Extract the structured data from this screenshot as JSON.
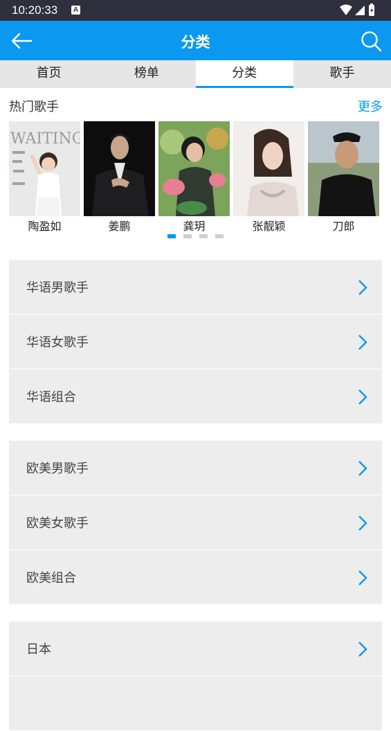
{
  "status": {
    "time": "10:20:33",
    "badge": "A"
  },
  "appbar": {
    "title": "分类"
  },
  "tabs": [
    {
      "label": "首页"
    },
    {
      "label": "榜单"
    },
    {
      "label": "分类"
    },
    {
      "label": "歌手"
    }
  ],
  "hot": {
    "title": "热门歌手",
    "more": "更多",
    "singers": [
      {
        "name": "陶盈如",
        "photo_text": "WAITING"
      },
      {
        "name": "姜鹏"
      },
      {
        "name": "龚玥"
      },
      {
        "name": "张靓颖"
      },
      {
        "name": "刀郎"
      }
    ],
    "page_count": 4,
    "active_page": 1
  },
  "groups": [
    {
      "items": [
        {
          "label": "华语男歌手"
        },
        {
          "label": "华语女歌手"
        },
        {
          "label": "华语组合"
        }
      ]
    },
    {
      "items": [
        {
          "label": "欧美男歌手"
        },
        {
          "label": "欧美女歌手"
        },
        {
          "label": "欧美组合"
        }
      ]
    },
    {
      "items": [
        {
          "label": "日本"
        },
        {
          "label": ""
        }
      ]
    }
  ],
  "colors": {
    "accent": "#0a98f0",
    "statusbar": "#2f2f3d",
    "row_bg": "#ededed",
    "tab_bg": "#e6e6e6"
  },
  "icons": {
    "back": "arrow-left-icon",
    "search": "search-icon",
    "chevron": "chevron-right-icon"
  }
}
